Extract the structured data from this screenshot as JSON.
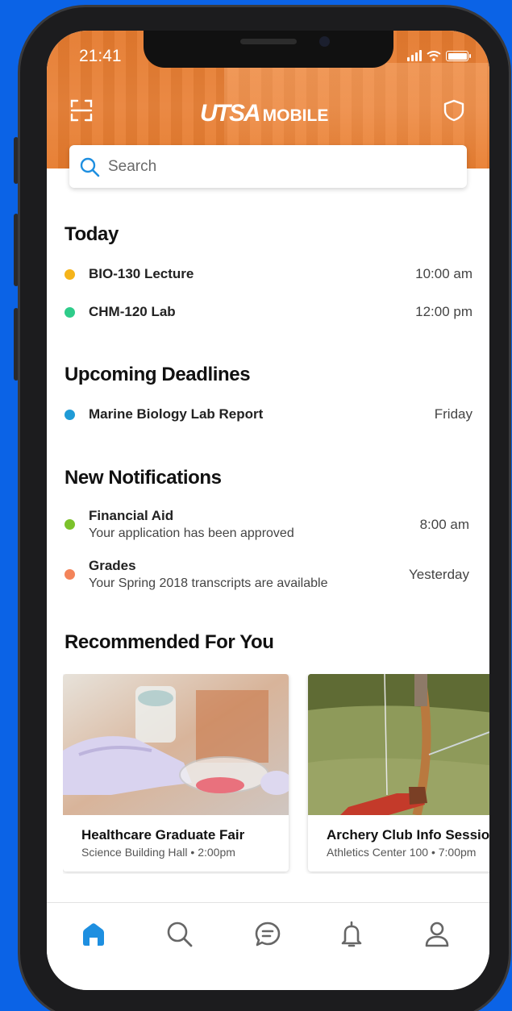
{
  "status_bar": {
    "time": "21:41"
  },
  "header": {
    "logo_primary": "UTSA",
    "logo_secondary": "MOBILE"
  },
  "search": {
    "placeholder": "Search"
  },
  "today": {
    "title": "Today",
    "items": [
      {
        "label": "BIO-130 Lecture",
        "time": "10:00 am",
        "color": "#f5b41a"
      },
      {
        "label": "CHM-120 Lab",
        "time": "12:00 pm",
        "color": "#2ecc8a"
      }
    ]
  },
  "deadlines": {
    "title": "Upcoming Deadlines",
    "items": [
      {
        "label": "Marine Biology Lab Report",
        "due": "Friday",
        "color": "#1f9bd6"
      }
    ]
  },
  "notifications": {
    "title": "New Notifications",
    "items": [
      {
        "title": "Financial Aid",
        "message": "Your application has been approved",
        "time": "8:00 am",
        "color": "#7cc22b"
      },
      {
        "title": "Grades",
        "message": "Your Spring 2018 transcripts are available",
        "time": "Yesterday",
        "color": "#f3845a"
      }
    ]
  },
  "recommended": {
    "title": "Recommended For You",
    "cards": [
      {
        "title": "Healthcare Graduate Fair",
        "subtitle": "Science Building Hall • 2:00pm"
      },
      {
        "title": "Archery Club Info Session",
        "subtitle": "Athletics Center 100 • 7:00pm"
      }
    ]
  },
  "tab_bar": {
    "active_color": "#1e8fe0",
    "inactive_color": "#666666",
    "tabs": [
      {
        "icon": "home-icon",
        "active": true
      },
      {
        "icon": "search-icon",
        "active": false
      },
      {
        "icon": "chat-icon",
        "active": false
      },
      {
        "icon": "bell-icon",
        "active": false
      },
      {
        "icon": "user-icon",
        "active": false
      }
    ]
  },
  "colors": {
    "brand_orange": "#e67a2c",
    "background_blue": "#0b63e6"
  }
}
